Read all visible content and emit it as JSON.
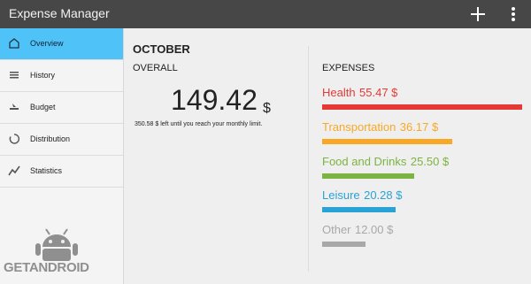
{
  "app": {
    "title": "Expense Manager"
  },
  "topbar": {
    "add_icon": "plus-icon",
    "overflow_icon": "overflow-menu-icon"
  },
  "sidebar": {
    "items": [
      {
        "label": "Overview",
        "icon": "home-icon",
        "active": true
      },
      {
        "label": "History",
        "icon": "list-icon",
        "active": false
      },
      {
        "label": "Budget",
        "icon": "budget-icon",
        "active": false
      },
      {
        "label": "Distribution",
        "icon": "distribution-icon",
        "active": false
      },
      {
        "label": "Statistics",
        "icon": "chart-line-icon",
        "active": false
      }
    ]
  },
  "watermark": {
    "text": "GETANDROID"
  },
  "overview": {
    "month": "OCTOBER",
    "overall_label": "OVERALL",
    "total": "149.42",
    "currency": "$",
    "remaining_text": "350.58 $ left until you reach your monthly limit."
  },
  "expenses": {
    "title": "EXPENSES",
    "items": [
      {
        "name": "Health",
        "amount": "55.47 $",
        "value": 55.47,
        "color": "#e53935"
      },
      {
        "name": "Transportation",
        "amount": "36.17 $",
        "value": 36.17,
        "color": "#f9a825"
      },
      {
        "name": "Food and Drinks",
        "amount": "25.50 $",
        "value": 25.5,
        "color": "#7cb342"
      },
      {
        "name": "Leisure",
        "amount": "20.28 $",
        "value": 20.28,
        "color": "#29a3d6"
      },
      {
        "name": "Other",
        "amount": "12.00 $",
        "value": 12.0,
        "color": "#a8a8a8"
      }
    ]
  }
}
